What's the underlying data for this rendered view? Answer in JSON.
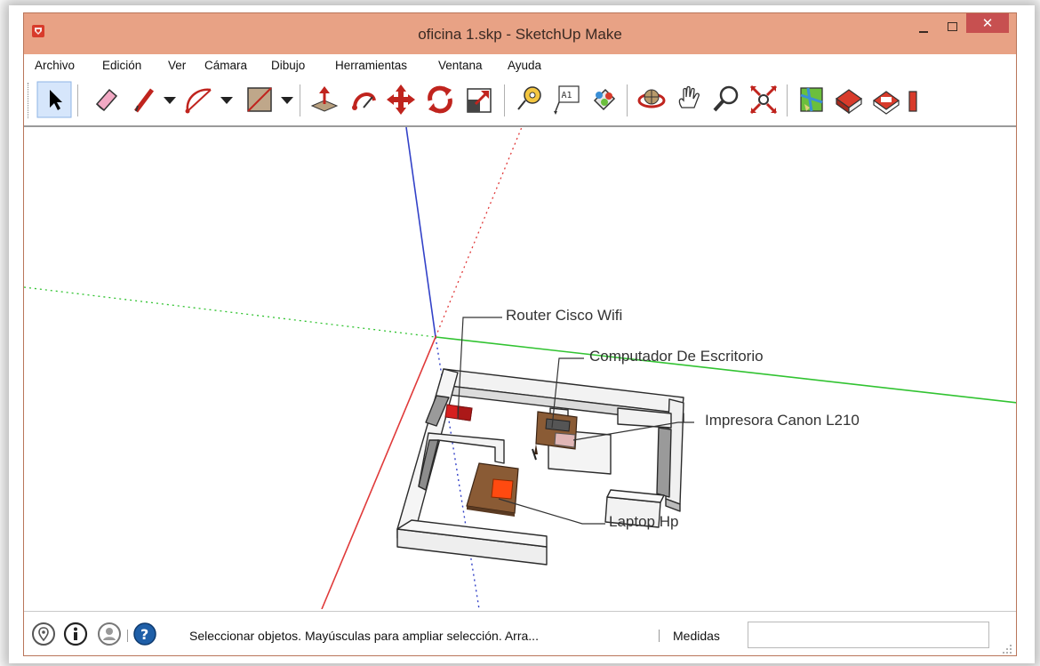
{
  "window": {
    "title": "oficina 1.skp - SketchUp Make",
    "minimize_symbol": "",
    "close_symbol": "✕",
    "accent_color": "#e8a285"
  },
  "menu": {
    "items": [
      "Archivo",
      "Edición",
      "Ver",
      "Cámara",
      "Dibujo",
      "Herramientas",
      "Ventana",
      "Ayuda"
    ]
  },
  "toolbar": {
    "tools": [
      "select-arrow-icon",
      "eraser-icon",
      "pencil-line-icon",
      "dropdown-arrow-icon",
      "arc-icon",
      "dropdown-arrow-icon",
      "rectangle-icon",
      "dropdown-arrow-icon",
      "push-pull-icon",
      "follow-me-icon",
      "move-icon",
      "rotate-icon",
      "scale-icon",
      "tape-measure-icon",
      "text-label-icon",
      "paint-bucket-icon",
      "orbit-icon",
      "pan-hand-icon",
      "zoom-magnifier-icon",
      "zoom-extents-icon",
      "map-icon",
      "warehouse-icon",
      "extension-icon"
    ],
    "text_tool_label": "A1"
  },
  "scene": {
    "labels": {
      "router": "Router Cisco Wifi",
      "computer": "Computador De Escritorio",
      "printer": "Impresora Canon L210",
      "laptop": "Laptop Hp"
    },
    "axis_colors": {
      "red": "#e03a3a",
      "green": "#31c331",
      "blue": "#3342c8"
    }
  },
  "status": {
    "icons": [
      "geo-location-icon",
      "info-icon",
      "user-account-icon",
      "help-icon"
    ],
    "message": "Seleccionar objetos. Mayúsculas para ampliar selección. Arra...",
    "measurements_label": "Medidas",
    "measurements_value": ""
  }
}
